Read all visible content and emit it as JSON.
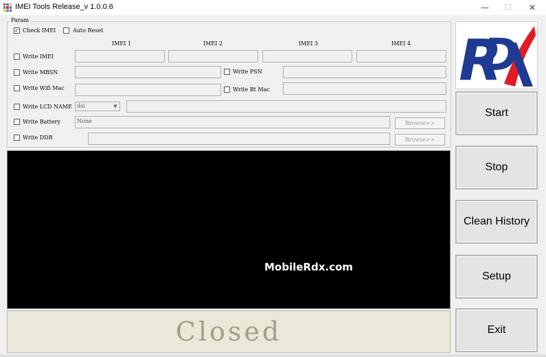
{
  "window": {
    "title": "IMEI Tools Release_v 1.0.0.6",
    "minimize": "—",
    "maximize": "☐",
    "close": "✕"
  },
  "param": {
    "legend": "Param",
    "check_imei": {
      "label": "Check IMEI",
      "checked": true,
      "mark": "✓"
    },
    "auto_reset": {
      "label": "Auto Reset",
      "checked": false
    },
    "imei_headers": [
      "IMEI 1",
      "IMEI 2",
      "IMEI 3",
      "IMEI 4"
    ],
    "write_imei": {
      "label": "Write IMEI"
    },
    "write_mbsn": {
      "label": "Write MBSN"
    },
    "write_psn": {
      "label": "Write PSN"
    },
    "write_wifi_mac": {
      "label": "Write Wifi Mac"
    },
    "write_bt_mac": {
      "label": "Write Bt Mac"
    },
    "write_lcd_name": {
      "label": "Write LCD NAME",
      "selected": "dsi"
    },
    "write_battery": {
      "label": "Write Battery",
      "value": "None",
      "browse": "Browse>>"
    },
    "write_ddr": {
      "label": "Write DDR",
      "browse": "Browse>>"
    }
  },
  "console": {
    "watermark": "MobileRdx.com"
  },
  "status": {
    "text": "Closed"
  },
  "logo": {
    "text": "RDX"
  },
  "buttons": {
    "start": "Start",
    "stop": "Stop",
    "clean_history": "Clean History",
    "setup": "Setup",
    "exit": "Exit"
  },
  "colors": {
    "logo_blue": "#1f3a93",
    "logo_red": "#e01b24",
    "status_bg": "#e9e8d9",
    "status_text": "#9fa086"
  }
}
